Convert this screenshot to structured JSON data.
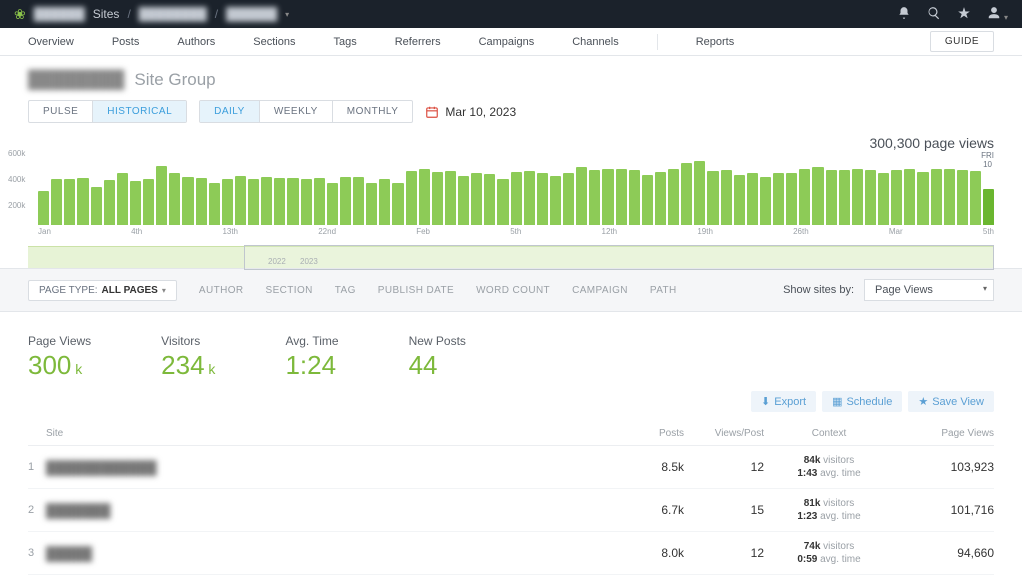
{
  "topbar": {
    "brand_blur": "██████",
    "sites_label": "Sites",
    "crumb1_blur": "████████",
    "crumb2_blur": "██████"
  },
  "subnav": {
    "items": [
      "Overview",
      "Posts",
      "Authors",
      "Sections",
      "Tags",
      "Referrers",
      "Campaigns",
      "Channels"
    ],
    "reports": "Reports",
    "guide": "GUIDE"
  },
  "header": {
    "title_blur": "████████",
    "subtitle": "Site Group"
  },
  "view_seg": {
    "pulse": "PULSE",
    "historical": "HISTORICAL"
  },
  "range_seg": {
    "daily": "DAILY",
    "weekly": "WEEKLY",
    "monthly": "MONTHLY"
  },
  "date": "Mar 10, 2023",
  "chart_total": "300,300 page views",
  "chart_day_label": {
    "dow": "FRI",
    "day": "10"
  },
  "chart_data": {
    "type": "bar",
    "title": "Page views by day",
    "xlabel": "",
    "ylabel": "",
    "ylim": [
      0,
      600000
    ],
    "yticks": [
      "600k",
      "400k",
      "200k"
    ],
    "categories": [
      "Jan",
      "",
      "",
      "4th",
      "",
      "",
      "",
      "",
      "",
      "",
      "13th",
      "",
      "",
      "",
      "",
      "",
      "",
      "",
      "",
      "22nd",
      "",
      "",
      "",
      "",
      "",
      "",
      "",
      "",
      "",
      "Feb",
      "",
      "",
      "",
      "",
      "5th",
      "",
      "",
      "",
      "",
      "",
      "",
      "",
      "12th",
      "",
      "",
      "",
      "",
      "",
      "",
      "",
      "19th",
      "",
      "",
      "",
      "",
      "",
      "",
      "",
      "26th",
      "",
      "",
      "",
      "",
      "Mar",
      "",
      "",
      "",
      "",
      "5th",
      "",
      "",
      "",
      "",
      ""
    ],
    "values": [
      280,
      380,
      380,
      390,
      320,
      375,
      430,
      370,
      385,
      490,
      430,
      400,
      395,
      350,
      380,
      405,
      380,
      400,
      390,
      395,
      380,
      390,
      350,
      400,
      400,
      350,
      380,
      350,
      450,
      470,
      440,
      450,
      405,
      430,
      425,
      385,
      440,
      450,
      430,
      410,
      430,
      485,
      460,
      470,
      465,
      460,
      415,
      445,
      465,
      520,
      530,
      450,
      460,
      420,
      430,
      400,
      430,
      430,
      470,
      480,
      455,
      460,
      465,
      455,
      430,
      455,
      470,
      440,
      465,
      465,
      460,
      450,
      300
    ]
  },
  "mini": {
    "left_label": "2022",
    "right_label": "2023"
  },
  "filters": {
    "pagetype_label": "PAGE TYPE:",
    "pagetype_value": "ALL PAGES",
    "items": [
      "AUTHOR",
      "SECTION",
      "TAG",
      "PUBLISH DATE",
      "WORD COUNT",
      "CAMPAIGN",
      "PATH"
    ],
    "show_sites_by": "Show sites by:",
    "select_value": "Page Views"
  },
  "metrics": [
    {
      "label": "Page Views",
      "value": "300",
      "suffix": "k"
    },
    {
      "label": "Visitors",
      "value": "234",
      "suffix": "k"
    },
    {
      "label": "Avg. Time",
      "value": "1:24",
      "suffix": ""
    },
    {
      "label": "New Posts",
      "value": "44",
      "suffix": ""
    }
  ],
  "actions": {
    "export": "Export",
    "schedule": "Schedule",
    "save": "Save View"
  },
  "table": {
    "headers": {
      "site": "Site",
      "posts": "Posts",
      "views_post": "Views/Post",
      "context": "Context",
      "page_views": "Page Views"
    },
    "rows": [
      {
        "idx": "1",
        "site_blur": "████████████",
        "posts": "8.5k",
        "views_post": "12",
        "ctx_top": "84k visitors",
        "ctx_bot": "1:43  avg. time",
        "page_views": "103,923"
      },
      {
        "idx": "2",
        "site_blur": "███████",
        "posts": "6.7k",
        "views_post": "15",
        "ctx_top": "81k visitors",
        "ctx_bot": "1:23  avg. time",
        "page_views": "101,716"
      },
      {
        "idx": "3",
        "site_blur": "█████",
        "posts": "8.0k",
        "views_post": "12",
        "ctx_top": "74k visitors",
        "ctx_bot": "0:59  avg. time",
        "page_views": "94,660"
      }
    ]
  }
}
